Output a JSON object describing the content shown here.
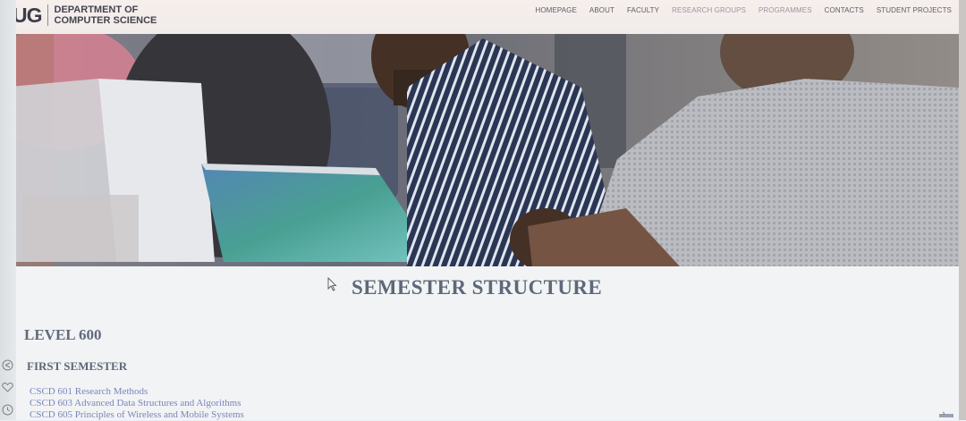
{
  "header": {
    "logo": {
      "abbr": "UG",
      "line1": "DEPARTMENT OF",
      "line2": "COMPUTER SCIENCE"
    },
    "nav": [
      {
        "label": "HOMEPAGE"
      },
      {
        "label": "ABOUT"
      },
      {
        "label": "FACULTY"
      },
      {
        "label": "RESEARCH GROUPS"
      },
      {
        "label": "PROGRAMMES"
      },
      {
        "label": "CONTACTS"
      },
      {
        "label": "STUDENT PROJECTS"
      }
    ]
  },
  "hero": {
    "image": "students-with-laptops-photo"
  },
  "main": {
    "title": "SEMESTER STRUCTURE",
    "level": "LEVEL 600",
    "semester": "FIRST SEMESTER",
    "courses": [
      {
        "label": "CSCD 601 Research Methods"
      },
      {
        "label": "CSCD 603 Advanced Data Structures and Algorithms"
      },
      {
        "label": "CSCD 605 Principles of Wireless and Mobile Systems"
      }
    ]
  },
  "rail_icons": [
    "share-icon",
    "heart-icon",
    "clock-icon"
  ],
  "colors": {
    "heading": "#5e6878",
    "link": "#7a86b8",
    "header_bg": "#f4eeeb",
    "nav_text": "#5d5d68"
  }
}
